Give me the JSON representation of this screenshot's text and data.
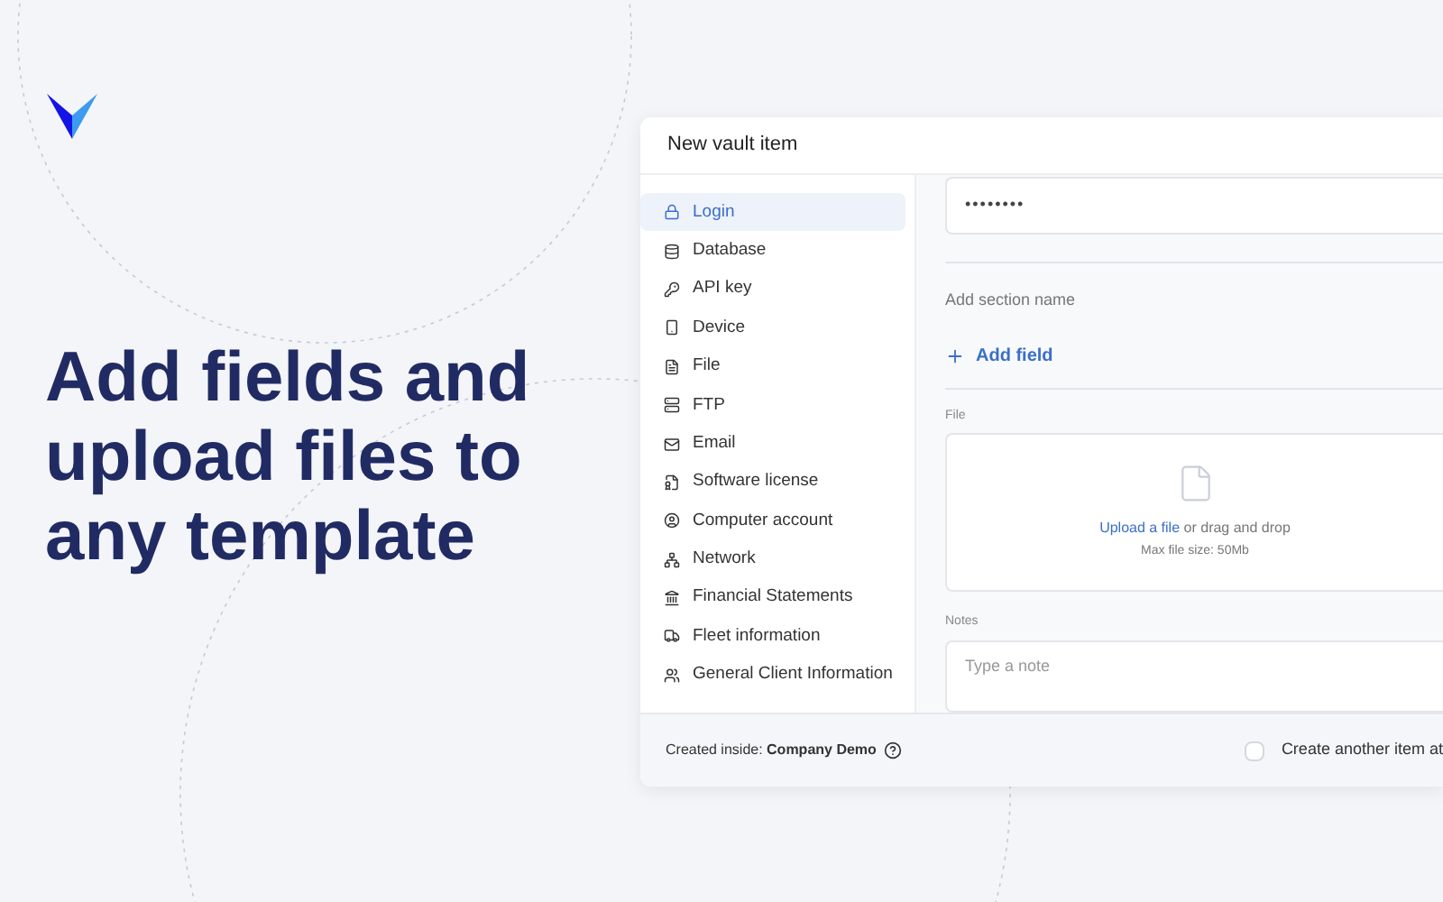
{
  "headline": "Add fields and upload files to any template",
  "dialog": {
    "title": "New vault item",
    "sidebar": {
      "items": [
        {
          "label": "Login",
          "selected": true
        },
        {
          "label": "Database",
          "selected": false
        },
        {
          "label": "API key",
          "selected": false
        },
        {
          "label": "Device",
          "selected": false
        },
        {
          "label": "File",
          "selected": false
        },
        {
          "label": "FTP",
          "selected": false
        },
        {
          "label": "Email",
          "selected": false
        },
        {
          "label": "Software license",
          "selected": false
        },
        {
          "label": "Computer account",
          "selected": false
        },
        {
          "label": "Network",
          "selected": false
        },
        {
          "label": "Financial Statements",
          "selected": false
        },
        {
          "label": "Fleet information",
          "selected": false
        },
        {
          "label": "General Client Information",
          "selected": false
        }
      ]
    },
    "password_value": "••••••••",
    "section_name_placeholder": "Add section name",
    "add_field": "Add field",
    "file": {
      "label": "File",
      "upload_link": "Upload a file",
      "upload_rest": "or drag and drop",
      "max_size": "Max file size: 50Mb"
    },
    "notes": {
      "label": "Notes",
      "placeholder": "Type a note"
    },
    "footer": {
      "created_inside": "Created inside: **Company Demo**",
      "create_another": {
        "label": "Create another item at",
        "checked": false
      }
    }
  }
}
